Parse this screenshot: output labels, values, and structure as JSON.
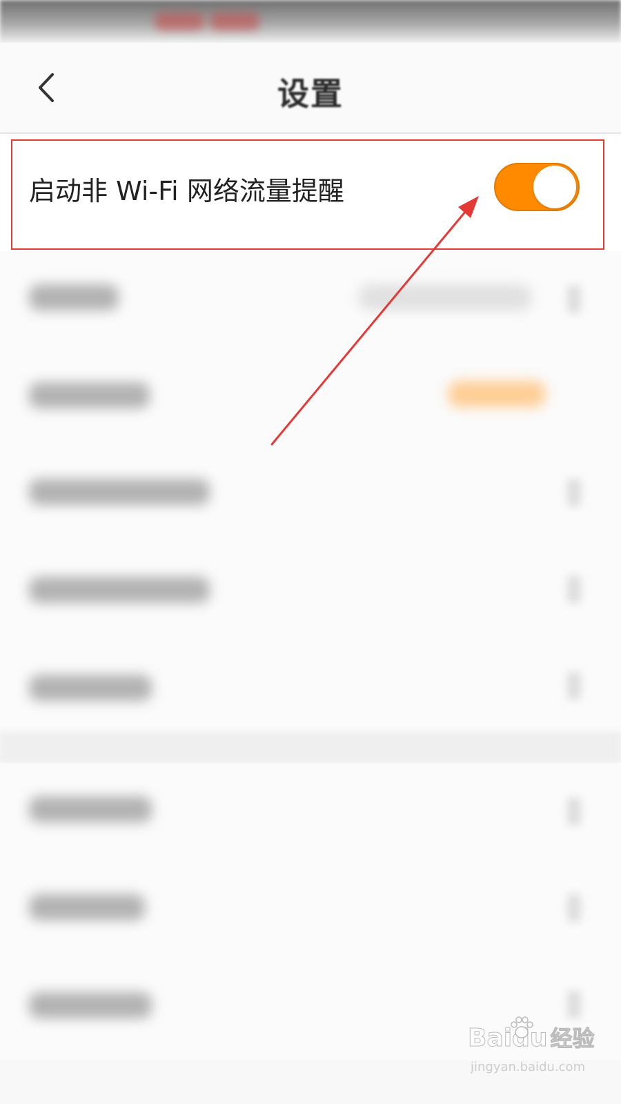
{
  "nav": {
    "back_icon": "chevron-left-icon",
    "title": "设置"
  },
  "setting": {
    "label": "启动非 Wi-Fi 网络流量提醒",
    "toggle_on": true,
    "toggle_color": "#ff8a00"
  },
  "annotation": {
    "frame_color": "#e53935",
    "arrow_color": "#e53935"
  },
  "watermark": {
    "brand": "Bai",
    "brand_suffix": "du",
    "brand_cn": "经验",
    "url": "jingyan.baidu.com"
  }
}
